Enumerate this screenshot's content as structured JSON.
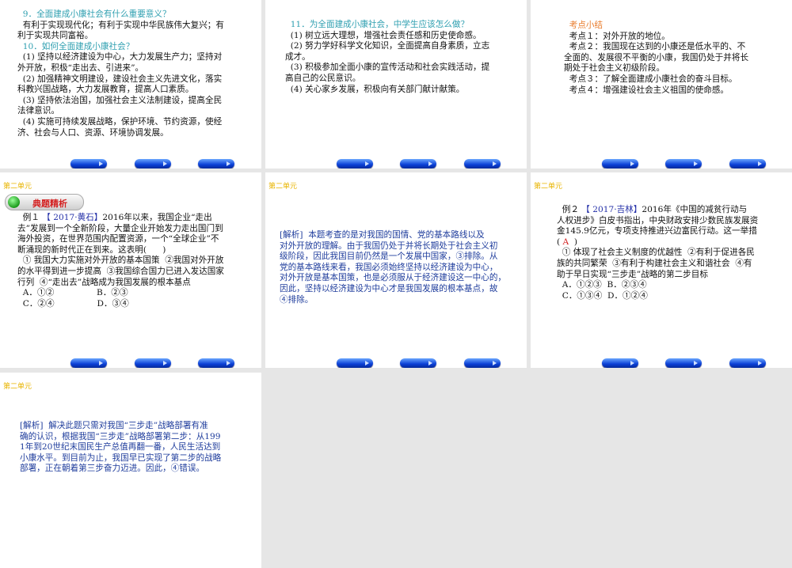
{
  "unit_label": "第二单元",
  "slides": [
    {
      "lines": [
        {
          "cls": "teal",
          "text": "  9．全面建成小康社会有什么重要意义？"
        },
        {
          "cls": "",
          "text": "  有利于实现现代化；有利于实现中华民族伟大复兴；有"
        },
        {
          "cls": "",
          "text": "利于实现共同富裕。"
        },
        {
          "cls": "teal",
          "text": "  10．如何全面建成小康社会？"
        },
        {
          "cls": "",
          "text": "  (1) 坚持以经济建设为中心，大力发展生产力；坚持对"
        },
        {
          "cls": "",
          "text": "外开放，积极“走出去、引进来”。"
        },
        {
          "cls": "",
          "text": "  (2) 加强精神文明建设，建设社会主义先进文化，落实"
        },
        {
          "cls": "",
          "text": "科教兴国战略，大力发展教育，提高人口素质。"
        },
        {
          "cls": "",
          "text": "  (3) 坚持依法治国，加强社会主义法制建设，提高全民"
        },
        {
          "cls": "",
          "text": "法律意识。"
        },
        {
          "cls": "",
          "text": "  (4) 实施可持续发展战略，保护环境、节约资源，使经"
        },
        {
          "cls": "",
          "text": "济、社会与人口、资源、环境协调发展。"
        }
      ]
    },
    {
      "lines": [
        {
          "cls": "teal",
          "text": "  11．为全面建成小康社会，中学生应该怎么做？"
        },
        {
          "cls": "",
          "text": "  (1) 树立远大理想，增强社会责任感和历史使命感。"
        },
        {
          "cls": "",
          "text": "  (2) 努力学好科学文化知识，全面提高自身素质，立志"
        },
        {
          "cls": "",
          "text": "成才。"
        },
        {
          "cls": "",
          "text": "  (3) 积极参加全面小康的宣传活动和社会实践活动，提"
        },
        {
          "cls": "",
          "text": "高自己的公民意识。"
        },
        {
          "cls": "",
          "text": "  (4) 关心家乡发展，积极向有关部门献计献策。"
        }
      ]
    },
    {
      "lines": [
        {
          "cls": "orange",
          "text": "  考点小结"
        },
        {
          "cls": "",
          "text": "  考点１：对外开放的地位。"
        },
        {
          "cls": "",
          "text": "  考点２：我国现在达到的小康还是低水平的、不"
        },
        {
          "cls": "",
          "text": "全面的、发展很不平衡的小康，我国仍处于并将长"
        },
        {
          "cls": "",
          "text": "期处于社会主义初级阶段。"
        },
        {
          "cls": "",
          "text": "  考点３：了解全面建成小康社会的奋斗目标。"
        },
        {
          "cls": "",
          "text": "  考点４：增强建设社会主义祖国的使命感。"
        }
      ]
    },
    {
      "header": "典题精析",
      "example_label": "  例１ ",
      "source": "【 2017·黄石】",
      "first_line_rest": "2016年以来，我国企业“走出",
      "lines": [
        {
          "cls": "",
          "text": "去”发展到一个全新阶段，大量企业开始发力走出国门到"
        },
        {
          "cls": "",
          "text": "海外投资，在世界范围内配置资源，一个“全球企业”不"
        },
        {
          "cls": "",
          "text": "断涌现的新时代正在到来。这表明(      )"
        },
        {
          "cls": "",
          "text": "  ① 我国大力实施对外开放的基本国策  ②我国对外开放"
        },
        {
          "cls": "",
          "text": "的水平得到进一步提高  ③我国综合国力已进入发达国家"
        },
        {
          "cls": "",
          "text": "行列  ④“走出去”战略成为我国发展的根本基点"
        },
        {
          "cls": "",
          "text": "  A．①②                B．②③"
        },
        {
          "cls": "",
          "text": "  C．②④                D．③④"
        }
      ]
    },
    {
      "lines": [
        {
          "cls": "blue",
          "text": "[解析]  本题考查的是对我国的国情、党的基本路线以及"
        },
        {
          "cls": "blue",
          "text": "对外开放的理解。由于我国仍处于并将长期处于社会主义初"
        },
        {
          "cls": "blue",
          "text": "级阶段，因此我国目前仍然是一个发展中国家，③排除。从"
        },
        {
          "cls": "blue",
          "text": "党的基本路线来看，我国必须始终坚持以经济建设为中心，"
        },
        {
          "cls": "blue",
          "text": "对外开放是基本国策，也是必须服从于经济建设这一中心的，"
        },
        {
          "cls": "blue",
          "text": "因此，坚持以经济建设为中心才是我国发展的根本基点，故"
        },
        {
          "cls": "blue",
          "text": "④排除。"
        }
      ]
    },
    {
      "example_label": "  例２ ",
      "source": "【 2017·吉林】",
      "first_line_rest": "2016年《中国的减贫行动与",
      "answer": "A",
      "lines": [
        {
          "cls": "",
          "text": "人权进步》白皮书指出，中央财政安排少数民族发展资"
        },
        {
          "cls": "",
          "text": "金145.9亿元，专项支持推进兴边富民行动。这一举措"
        }
      ],
      "lines2": [
        {
          "cls": "",
          "text": "  ① 体现了社会主义制度的优越性  ②有利于促进各民"
        },
        {
          "cls": "",
          "text": "族的共同繁荣  ③有利于构建社会主义和谐社会  ④有"
        },
        {
          "cls": "",
          "text": "助于早日实现“三步走”战略的第二步目标"
        },
        {
          "cls": "",
          "text": "  A．①②③  B．②③④"
        },
        {
          "cls": "",
          "text": "  C．①③④  D．①②④"
        }
      ]
    },
    {
      "lines": [
        {
          "cls": "blue",
          "text": "[解析]  解决此题只需对我国“三步走”战略部署有准"
        },
        {
          "cls": "blue",
          "text": "确的认识，根据我国“三步走”战略部署第二步：从199"
        },
        {
          "cls": "blue",
          "text": "1年到20世纪末国民生产总值再翻一番，人民生活达到"
        },
        {
          "cls": "blue",
          "text": "小康水平。到目前为止，我国早已实现了第二步的战略"
        },
        {
          "cls": "blue",
          "text": "部署，正在朝着第三步奋力迈进。因此，④错误。"
        }
      ]
    }
  ],
  "colors": {
    "accent_blue": "#1e3c9c",
    "teal": "#2e9fb0",
    "unit": "#e8b400",
    "answer": "#d21c1c"
  }
}
